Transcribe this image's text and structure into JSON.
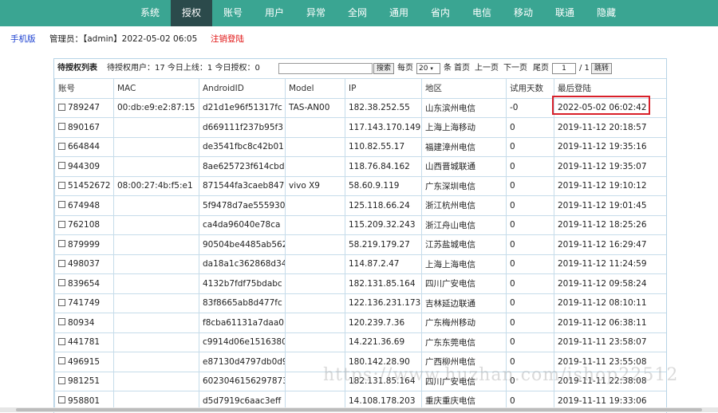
{
  "nav": [
    {
      "label": "系统",
      "active": false
    },
    {
      "label": "授权",
      "active": true
    },
    {
      "label": "账号",
      "active": false
    },
    {
      "label": "用户",
      "active": false
    },
    {
      "label": "异常",
      "active": false
    },
    {
      "label": "全网",
      "active": false
    },
    {
      "label": "通用",
      "active": false
    },
    {
      "label": "省内",
      "active": false
    },
    {
      "label": "电信",
      "active": false
    },
    {
      "label": "移动",
      "active": false
    },
    {
      "label": "联通",
      "active": false
    },
    {
      "label": "隐藏",
      "active": false
    }
  ],
  "info": {
    "mobile_link": "手机版",
    "admin_text": "管理员：【admin】2022-05-02 06:05",
    "logout": "注销登陆"
  },
  "toolbar": {
    "title": "待授权列表",
    "stats": "待授权用户：17  今日上线：1  今日授权：0",
    "search_value": "",
    "search_btn": "搜索",
    "per_page_label": "每页",
    "per_page_value": "20",
    "per_page_unit": "条",
    "first": "首页",
    "prev": "上一页",
    "next": "下一页",
    "last": "尾页",
    "page_value": "1",
    "page_total": "/ 1",
    "jump_btn": "跳转"
  },
  "table": {
    "headers": [
      "账号",
      "MAC",
      "AndroidID",
      "Model",
      "IP",
      "地区",
      "试用天数",
      "最后登陆"
    ],
    "rows": [
      [
        "789247",
        "00:db:e9:e2:87:15",
        "d21d1e96f51317fc",
        "TAS-AN00",
        "182.38.252.55",
        "山东滨州电信",
        "-0",
        "2022-05-02 06:02:42"
      ],
      [
        "890167",
        "",
        "d669111f237b95f3",
        "",
        "117.143.170.149",
        "上海上海移动",
        "0",
        "2019-11-12 20:18:57"
      ],
      [
        "664844",
        "",
        "de3541fbc8c42b01",
        "",
        "110.82.55.17",
        "福建漳州电信",
        "0",
        "2019-11-12 19:35:16"
      ],
      [
        "944309",
        "",
        "8ae625723f614cbd",
        "",
        "118.76.84.162",
        "山西晋城联通",
        "0",
        "2019-11-12 19:35:07"
      ],
      [
        "51452672",
        "08:00:27:4b:f5:e1",
        "871544fa3caeb847",
        "vivo X9",
        "58.60.9.119",
        "广东深圳电信",
        "0",
        "2019-11-12 19:10:12"
      ],
      [
        "674948",
        "",
        "5f9478d7ae555930",
        "",
        "125.118.66.24",
        "浙江杭州电信",
        "0",
        "2019-11-12 19:01:45"
      ],
      [
        "762108",
        "",
        "ca4da96040e78ca",
        "",
        "115.209.32.243",
        "浙江舟山电信",
        "0",
        "2019-11-12 18:25:26"
      ],
      [
        "879999",
        "",
        "90504be4485ab562",
        "",
        "58.219.179.27",
        "江苏盐城电信",
        "0",
        "2019-11-12 16:29:47"
      ],
      [
        "498037",
        "",
        "da18a1c362868d34",
        "",
        "114.87.2.47",
        "上海上海电信",
        "0",
        "2019-11-12 11:24:59"
      ],
      [
        "839654",
        "",
        "4132b7fdf75bdabc",
        "",
        "182.131.85.164",
        "四川广安电信",
        "0",
        "2019-11-12 09:58:24"
      ],
      [
        "741749",
        "",
        "83f8665ab8d477fc",
        "",
        "122.136.231.173",
        "吉林延边联通",
        "0",
        "2019-11-12 08:10:11"
      ],
      [
        "80934",
        "",
        "f8cba61131a7daa0",
        "",
        "120.239.7.36",
        "广东梅州移动",
        "0",
        "2019-11-12 06:38:11"
      ],
      [
        "441781",
        "",
        "c9914d06e1516380",
        "",
        "14.221.36.69",
        "广东东莞电信",
        "0",
        "2019-11-11 23:58:07"
      ],
      [
        "496915",
        "",
        "e87130d4797db0d9",
        "",
        "180.142.28.90",
        "广西柳州电信",
        "0",
        "2019-11-11 23:55:08"
      ],
      [
        "981251",
        "",
        "6023046156297873",
        "",
        "182.131.85.164",
        "四川广安电信",
        "0",
        "2019-11-11 22:38:08"
      ],
      [
        "958801",
        "",
        "d5d7919c6aac3eff",
        "",
        "14.108.178.203",
        "重庆重庆电信",
        "0",
        "2019-11-11 19:33:06"
      ]
    ]
  },
  "watermark": "https://www.huzhan.com/ishop22512",
  "colors": {
    "nav_bg": "#3aa592",
    "nav_active": "#2b4a4b",
    "highlight": "#d8202a",
    "logout": "#e01010",
    "link": "#1a3fd0"
  }
}
